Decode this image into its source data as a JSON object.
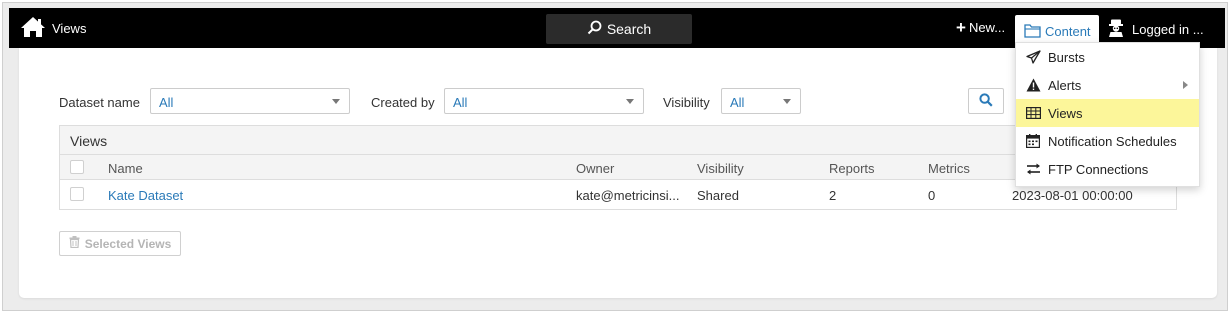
{
  "topbar": {
    "title": "Views",
    "search_label": "Search",
    "new_label": "New...",
    "content_label": "Content",
    "user_label": "Logged in ..."
  },
  "filters": {
    "dataset_label": "Dataset name",
    "dataset_value": "All",
    "created_by_label": "Created by",
    "created_by_value": "All",
    "visibility_label": "Visibility",
    "visibility_value": "All"
  },
  "grid": {
    "title": "Views",
    "columns": [
      "Name",
      "Owner",
      "Visibility",
      "Reports",
      "Metrics"
    ],
    "rows": [
      {
        "name": "Kate Dataset",
        "owner": "kate@metricinsi...",
        "visibility": "Shared",
        "reports": "2",
        "metrics": "0",
        "date": "2023-08-01 00:00:00"
      }
    ]
  },
  "actions": {
    "selected_views_label": "Selected Views"
  },
  "content_menu": {
    "items": [
      {
        "label": "Bursts",
        "icon": "paper-plane-icon"
      },
      {
        "label": "Alerts",
        "icon": "warning-icon"
      },
      {
        "label": "Views",
        "icon": "views-icon"
      },
      {
        "label": "Notification Schedules",
        "icon": "calendar-icon"
      },
      {
        "label": "FTP Connections",
        "icon": "transfer-arrows-icon"
      }
    ],
    "active_item": "Views"
  },
  "colors": {
    "topbar": "#000000",
    "link": "#2a7ab8",
    "menu_highlight": "#fcf69a"
  }
}
